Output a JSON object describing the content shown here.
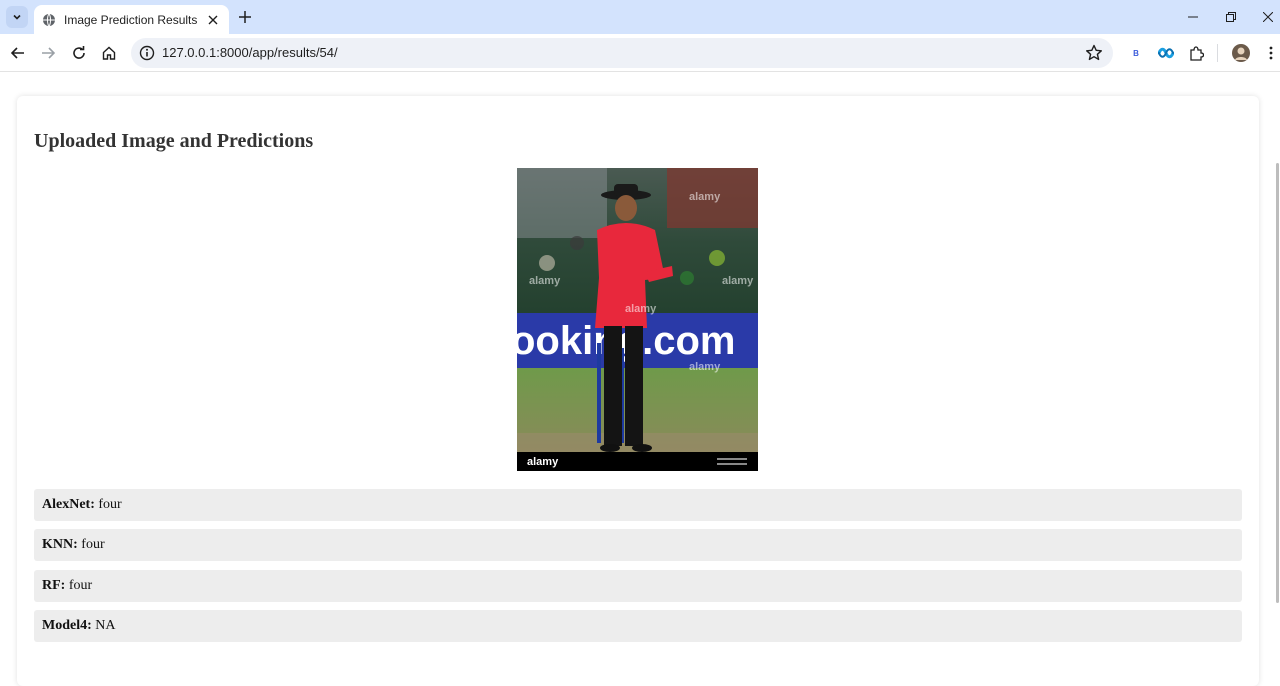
{
  "browser": {
    "tab_title": "Image Prediction Results",
    "url": "127.0.0.1:8000/app/results/54/",
    "extension_b_label": "B"
  },
  "page": {
    "heading": "Uploaded Image and Predictions",
    "image": {
      "watermark": "alamy",
      "banner_text": "ooking.com"
    },
    "predictions": [
      {
        "model": "AlexNet:",
        "value": "four"
      },
      {
        "model": "KNN:",
        "value": "four"
      },
      {
        "model": "RF:",
        "value": "four"
      },
      {
        "model": "Model4:",
        "value": "NA"
      }
    ]
  },
  "colors": {
    "tabstrip": "#d3e3fd",
    "prediction_bg": "#ededed",
    "umpire_jacket": "#e8283c"
  }
}
